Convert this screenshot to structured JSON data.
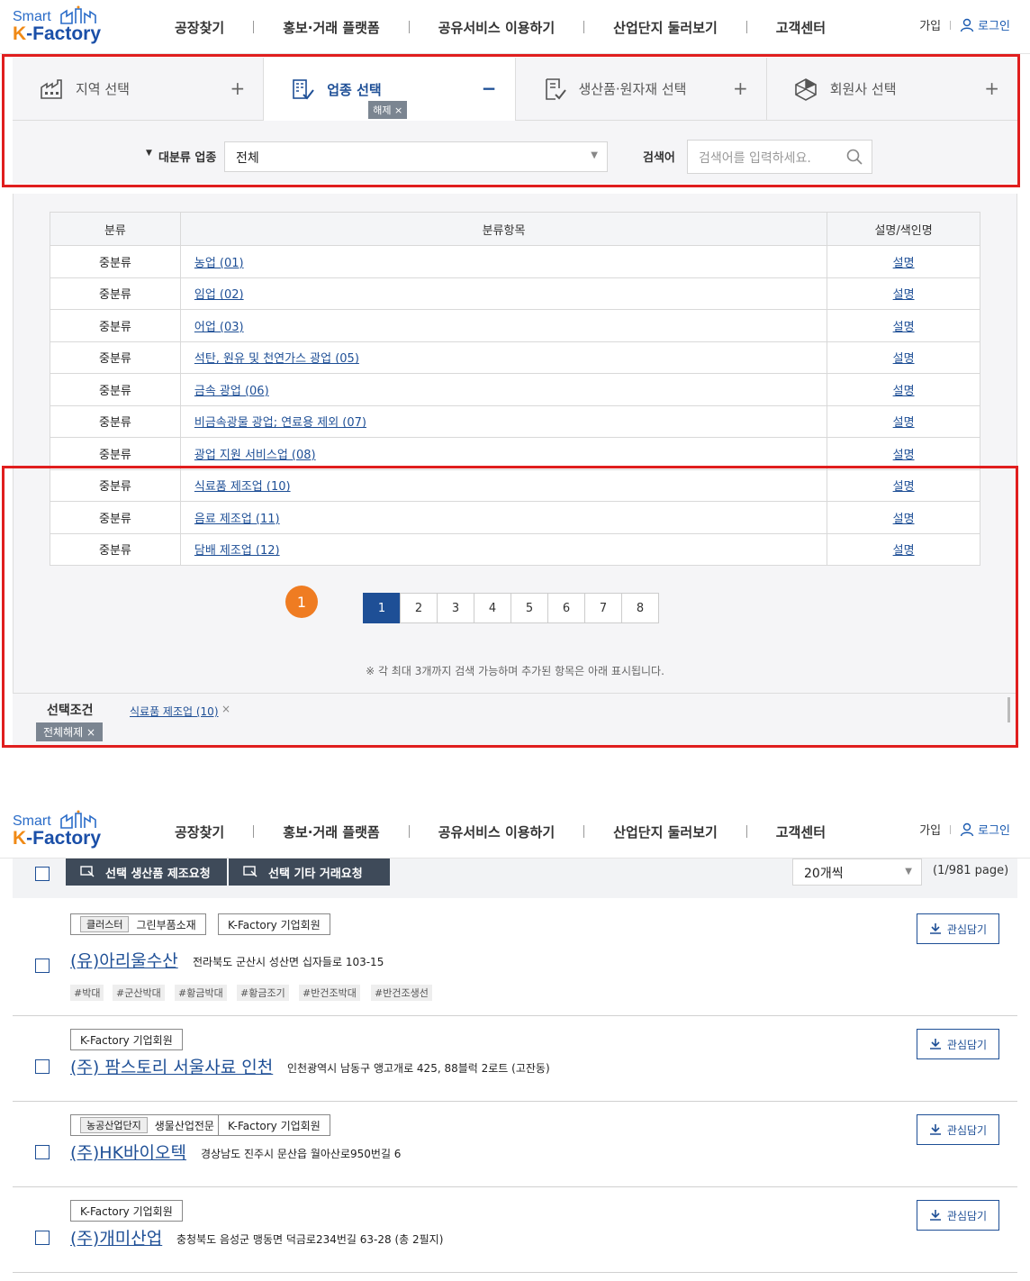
{
  "header": {
    "logo_top": "Smart",
    "logo_k": "K",
    "logo_rest": "-Factory",
    "nav": [
      "공장찾기",
      "홍보·거래 플랫폼",
      "공유서비스 이용하기",
      "산업단지 둘러보기",
      "고객센터"
    ],
    "join": "가입",
    "login": "로그인"
  },
  "tabs": [
    {
      "label": "지역 선택",
      "toggle": "+"
    },
    {
      "label": "업종 선택",
      "toggle": "−",
      "chip": "해제 ×"
    },
    {
      "label": "생산품·원자재 선택",
      "toggle": "+"
    },
    {
      "label": "회원사 선택",
      "toggle": "+"
    }
  ],
  "filter": {
    "category_label": "대분류 업종",
    "category_value": "전체",
    "search_label": "검색어",
    "search_placeholder": "검색어를 입력하세요."
  },
  "table": {
    "headers": [
      "분류",
      "분류항목",
      "설명/색인명"
    ],
    "rows": [
      {
        "type": "중분류",
        "item": "농업 (01)",
        "desc": "설명"
      },
      {
        "type": "중분류",
        "item": "임업 (02)",
        "desc": "설명"
      },
      {
        "type": "중분류",
        "item": "어업 (03)",
        "desc": "설명"
      },
      {
        "type": "중분류",
        "item": "석탄, 원유 및 천연가스 광업 (05)",
        "desc": "설명"
      },
      {
        "type": "중분류",
        "item": "금속 광업 (06)",
        "desc": "설명"
      },
      {
        "type": "중분류",
        "item": "비금속광물 광업; 연료용 제외 (07)",
        "desc": "설명"
      },
      {
        "type": "중분류",
        "item": "광업 지원 서비스업 (08)",
        "desc": "설명"
      },
      {
        "type": "중분류",
        "item": "식료품 제조업 (10)",
        "desc": "설명"
      },
      {
        "type": "중분류",
        "item": "음료 제조업 (11)",
        "desc": "설명"
      },
      {
        "type": "중분류",
        "item": "담배 제조업 (12)",
        "desc": "설명"
      }
    ]
  },
  "step_badge": "1",
  "pagination": {
    "pages": [
      "1",
      "2",
      "3",
      "4",
      "5",
      "6",
      "7",
      "8"
    ],
    "current": "1"
  },
  "note": "※ 각 최대 3개까지 검색 가능하며 추가된 항목은 아래 표시됩니다.",
  "conditions": {
    "label": "선택조건",
    "clear_all": "전체해제 ×",
    "items": [
      {
        "label": "식료품 제조업 (10)",
        "remove": "×"
      }
    ]
  },
  "toolbar": {
    "btn_produce": "선택 생산품 제조요청",
    "btn_trade": "선택 기타 거래요청",
    "per_page": "20개씩",
    "page_info": "(1/981 page)"
  },
  "companies": [
    {
      "name": "(유)아리울수산",
      "address": "전라북도 군산시 성산면 십자들로 103-15",
      "tags": [
        {
          "inner": "클러스터",
          "label": "그린부품소재"
        },
        {
          "label": "K-Factory 기업회원"
        }
      ],
      "hashtags": [
        "#박대",
        "#군산박대",
        "#황금박대",
        "#황금조기",
        "#반건조박대",
        "#반건조생선"
      ],
      "fav": "관심담기"
    },
    {
      "name": "(주) 팜스토리 서울사료 인천",
      "address": "인천광역시 남동구 앵고개로 425, 88블럭 2로트 (고잔동)",
      "tags": [
        {
          "label": "K-Factory 기업회원"
        }
      ],
      "hashtags": [],
      "fav": "관심담기"
    },
    {
      "name": "(주)HK바이오텍",
      "address": "경상남도 진주시 문산읍 월아산로950번길 6",
      "tags": [
        {
          "inner": "농공산업단지",
          "label": "생물산업전문"
        },
        {
          "label": "K-Factory 기업회원"
        }
      ],
      "hashtags": [],
      "fav": "관심담기"
    },
    {
      "name": "(주)개미산업",
      "address": "충청북도 음성군 맹동면 덕금로234번길 63-28 (총 2필지)",
      "tags": [
        {
          "label": "K-Factory 기업회원"
        }
      ],
      "hashtags": [],
      "fav": "관심담기"
    }
  ],
  "colors": {
    "brand": "#1e4f96",
    "highlight": "#e01e1e",
    "step": "#ef7c22"
  }
}
